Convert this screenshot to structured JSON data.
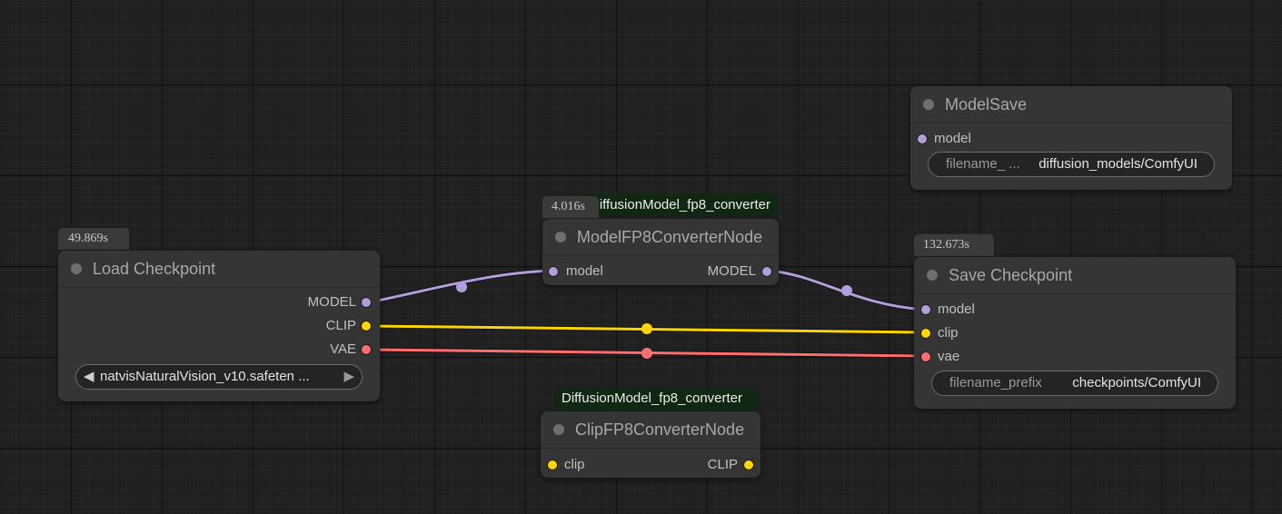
{
  "nodes": {
    "load_checkpoint": {
      "title": "Load Checkpoint",
      "time": "49.869s",
      "outputs": [
        "MODEL",
        "CLIP",
        "VAE"
      ],
      "widget": {
        "left_arrow": "◀",
        "value": "natvisNaturalVision_v10.safeten ...",
        "right_arrow": "▶"
      }
    },
    "model_fp8": {
      "title": "ModelFP8ConverterNode",
      "group": "DiffusionModel_fp8_converter",
      "time": "4.016s",
      "input": "model",
      "output": "MODEL"
    },
    "clip_fp8": {
      "title": "ClipFP8ConverterNode",
      "group": "DiffusionModel_fp8_converter",
      "input": "clip",
      "output": "CLIP"
    },
    "model_save": {
      "title": "ModelSave",
      "input": "model",
      "widget": {
        "label": "filename_ ...",
        "value": "diffusion_models/ComfyUI"
      }
    },
    "save_checkpoint": {
      "title": "Save Checkpoint",
      "time": "132.673s",
      "inputs": [
        "model",
        "clip",
        "vae"
      ],
      "widget": {
        "label": "filename_prefix",
        "value": "checkpoints/ComfyUI"
      }
    }
  },
  "colors": {
    "model": "#b39ddb",
    "clip": "#ffd500",
    "vae": "#ff6e6e",
    "node_bg": "#353535",
    "canvas_bg": "#202020",
    "group_title_bg": "#102712"
  }
}
